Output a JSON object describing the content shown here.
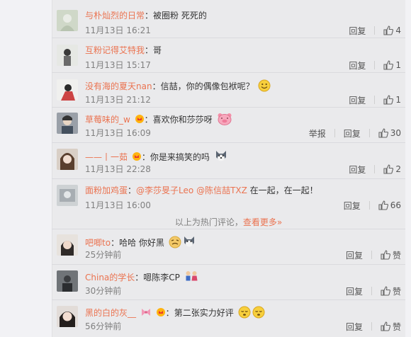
{
  "comments": [
    {
      "user": "与朴灿烈的日常",
      "sep": "：",
      "text": "被圈粉 死死的",
      "time": "11月13日 16:21",
      "reply": "回复",
      "likes": "4",
      "report": ""
    },
    {
      "user": "互粉记得艾特我",
      "sep": "：",
      "text": "哥",
      "time": "11月13日 15:17",
      "reply": "回复",
      "likes": "1",
      "report": ""
    },
    {
      "user": "没有海的夏天nan",
      "sep": "：",
      "text": "信喆，你的偶像包袱呢？",
      "time": "11月13日 21:12",
      "reply": "回复",
      "likes": "1",
      "report": ""
    },
    {
      "user": "草莓味的_w",
      "sep": "：",
      "text": "喜欢你和莎莎呀",
      "time": "11月13日 16:09",
      "reply": "回复",
      "likes": "30",
      "report": "举报"
    },
    {
      "user": "——丨一茹",
      "sep": "：",
      "text": "你是来搞笑的吗",
      "time": "11月13日 22:28",
      "reply": "回复",
      "likes": "2",
      "report": ""
    },
    {
      "user": "面粉加鸡蛋",
      "sep": "：",
      "mention1": "@李莎旻子Leo",
      "mention2": "@陈信喆TXZ",
      "text": " 在一起，在一起！",
      "time": "11月13日 16:00",
      "reply": "回复",
      "likes": "66",
      "report": ""
    },
    {
      "user": "吧唧to",
      "sep": "：",
      "text": "哈哈 你好黑",
      "time": "25分钟前",
      "reply": "回复",
      "likes": "赞",
      "report": ""
    },
    {
      "user": "China的学长",
      "sep": "：",
      "text": "嗯陈李CP",
      "time": "30分钟前",
      "reply": "回复",
      "likes": "赞",
      "report": ""
    },
    {
      "user": "黑的白的灰__",
      "sep": "：",
      "text": "第二张实力好评",
      "time": "56分钟前",
      "reply": "回复",
      "likes": "赞",
      "report": ""
    }
  ],
  "hot_divider": {
    "text": "以上为热门评论，",
    "more": "查看更多»"
  },
  "colors": {
    "username": "#eb7350",
    "meta": "#808080",
    "background": "#eaeaec"
  }
}
